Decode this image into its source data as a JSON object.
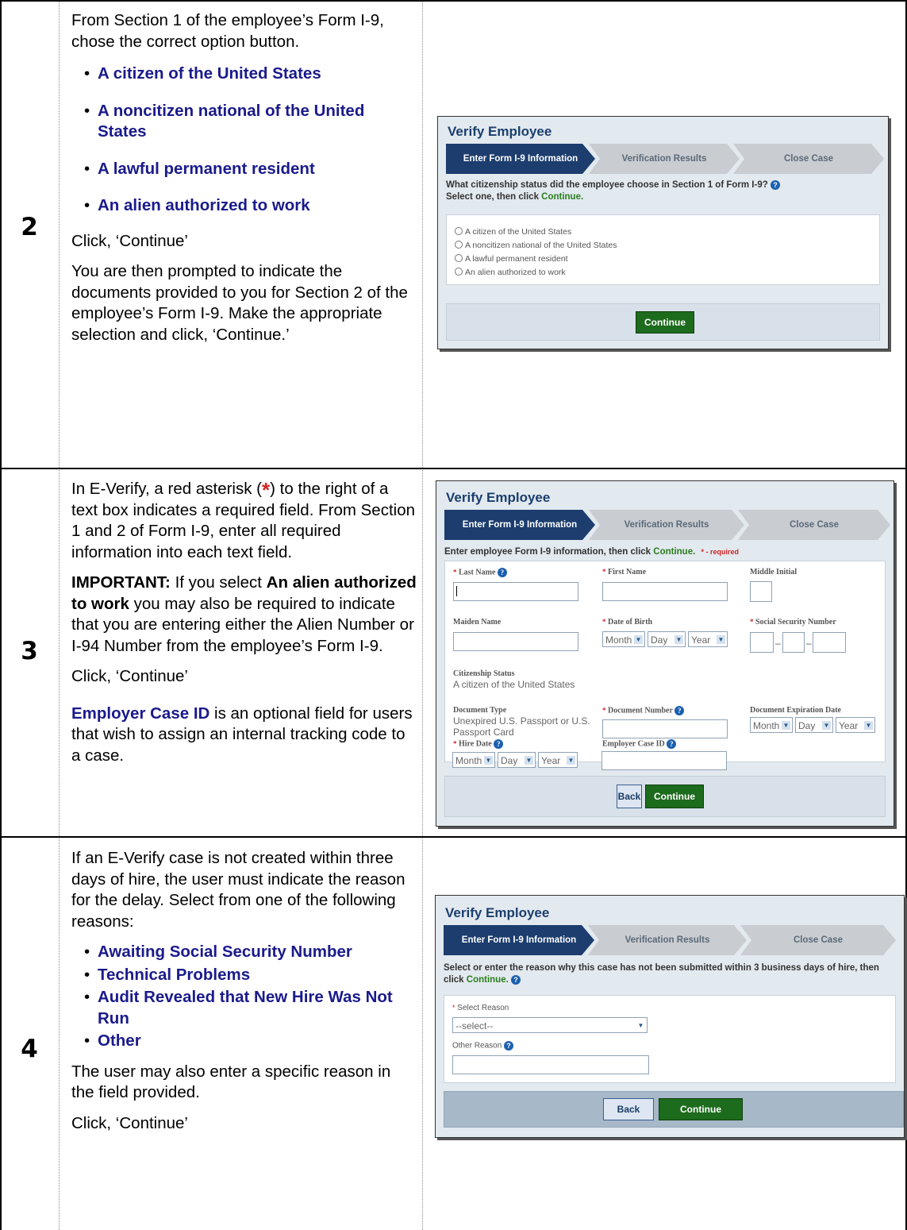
{
  "rows": [
    {
      "number": "2",
      "intro": "From Section 1 of the employee’s Form I-9, chose the correct option button.",
      "options": [
        "A citizen of the United States",
        "A noncitizen national of the United States",
        "A lawful permanent resident",
        "An alien authorized to work"
      ],
      "click": "Click, ‘Continue’",
      "outro": "You are then prompted to indicate the documents provided to you for Section 2 of the employee’s Form I-9. Make the appropriate selection and click, ‘Continue.’"
    },
    {
      "number": "3",
      "intro_a": "In E-Verify, a red asterisk (",
      "asterisk": "*",
      "intro_b": ") to the right of a text box indicates a required field. From Section 1 and 2 of Form I-9, enter all required information into each text field.",
      "important_label": "IMPORTANT:",
      "important_a": " If you select ",
      "important_b": "An alien authorized to work",
      "important_c": " you may also be required to indicate that you are entering either the Alien Number or I-94 Number from the employee’s Form I-9.",
      "click": "Click, ‘Continue’",
      "case_id_label": "Employer Case ID",
      "case_id_text": " is an optional field for users that wish to assign an internal tracking code to a case."
    },
    {
      "number": "4",
      "intro": "If an E-Verify case is not created within three days of hire, the user must indicate the reason for the delay. Select from one of the following reasons:",
      "options": [
        "Awaiting Social Security Number",
        "Technical Problems",
        "Audit Revealed that New Hire Was Not Run",
        "Other"
      ],
      "outro": "The user may also enter a specific reason in the field provided.",
      "click": "Click, ‘Continue’"
    }
  ],
  "shots": {
    "title": "Verify Employee",
    "steps": [
      "Enter Form I-9 Information",
      "Verification Results",
      "Close Case"
    ],
    "continue": "Continue",
    "back": "Back",
    "s1": {
      "question": "What citizenship status did the employee choose in Section 1 of Form I-9?",
      "select_a": "Select one, then click ",
      "select_b": "Continue.",
      "radios": [
        "A citizen of the United States",
        "A noncitizen national of the United States",
        "A lawful permanent resident",
        "An alien authorized to work"
      ]
    },
    "s2": {
      "instr_a": "Enter employee Form I-9 information, then click ",
      "instr_b": "Continue.",
      "required": "* - required",
      "last_name": "Last Name",
      "first_name": "First Name",
      "middle_initial": "Middle Initial",
      "maiden_name": "Maiden Name",
      "dob": "Date of Birth",
      "ssn": "Social Security Number",
      "citizenship_label": "Citizenship Status",
      "citizenship_value": "A citizen of the United States",
      "doc_type_label": "Document Type",
      "doc_type_value": "Unexpired U.S. Passport or U.S. Passport Card",
      "doc_number": "Document Number",
      "doc_exp": "Document Expiration Date",
      "hire_date": "Hire Date",
      "case_id": "Employer Case ID",
      "month": "Month",
      "day": "Day",
      "year": "Year"
    },
    "s3": {
      "instr_a": "Select or enter the reason why this case has not been submitted within 3 business days of hire, then click ",
      "instr_b": "Continue.",
      "select_reason": "Select Reason",
      "select_placeholder": "--select--",
      "other_reason": "Other Reason"
    }
  }
}
